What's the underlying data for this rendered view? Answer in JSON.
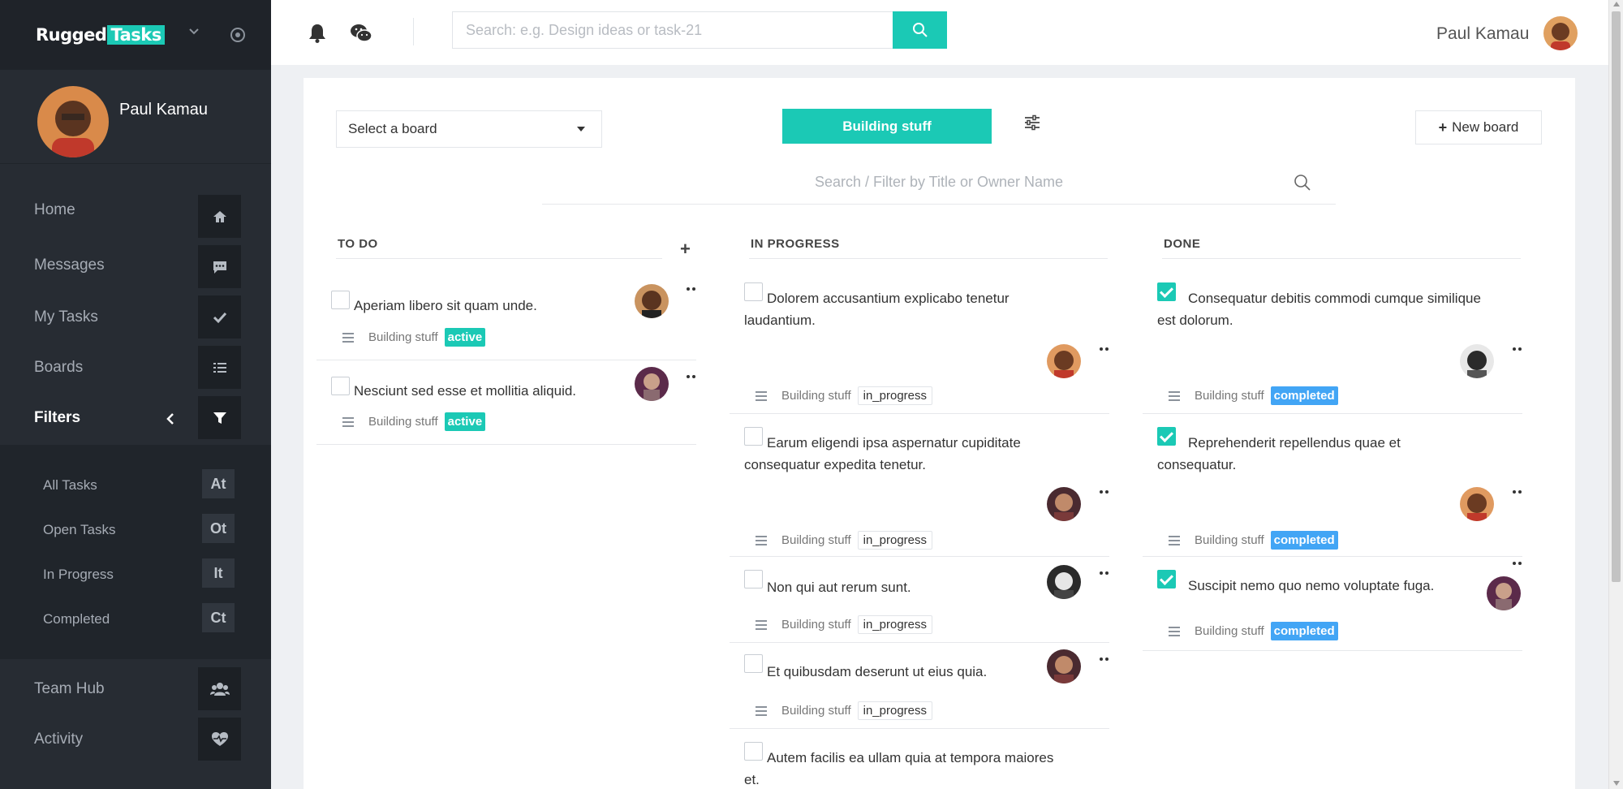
{
  "sidebar": {
    "brand_prefix": "Rugged",
    "brand_suffix": "Tasks",
    "profile_name": "Paul Kamau",
    "nav": [
      {
        "label": "Home",
        "icon": "home-icon"
      },
      {
        "label": "Messages",
        "icon": "message-icon"
      },
      {
        "label": "My Tasks",
        "icon": "check-icon"
      },
      {
        "label": "Boards",
        "icon": "list-icon"
      },
      {
        "label": "Filters",
        "icon": "filter-icon"
      }
    ],
    "filters": [
      {
        "label": "All Tasks",
        "badge": "At"
      },
      {
        "label": "Open Tasks",
        "badge": "Ot"
      },
      {
        "label": "In Progress",
        "badge": "It"
      },
      {
        "label": "Completed",
        "badge": "Ct"
      }
    ],
    "bottom_nav": [
      {
        "label": "Team Hub",
        "icon": "users-icon"
      },
      {
        "label": "Activity",
        "icon": "heartbeat-icon"
      }
    ]
  },
  "topbar": {
    "search_placeholder": "Search: e.g. Design ideas or task-21",
    "user_name": "Paul Kamau"
  },
  "board": {
    "select_label": "Select a board",
    "current_board": "Building stuff",
    "new_board_label": "New board",
    "filter_placeholder": "Search / Filter by Title or Owner Name"
  },
  "columns": {
    "todo": {
      "title": "TO DO",
      "cards": [
        {
          "title": "Aperiam libero sit quam unde.",
          "board": "Building stuff",
          "status": "active"
        },
        {
          "title": "Nesciunt sed esse et mollitia aliquid.",
          "board": "Building stuff",
          "status": "active"
        }
      ]
    },
    "in_progress": {
      "title": "IN PROGRESS",
      "cards": [
        {
          "title": "Dolorem accusantium explicabo tenetur laudantium.",
          "board": "Building stuff",
          "status": "in_progress"
        },
        {
          "title": "Earum eligendi ipsa aspernatur cupiditate consequatur expedita tenetur.",
          "board": "Building stuff",
          "status": "in_progress"
        },
        {
          "title": "Non qui aut rerum sunt.",
          "board": "Building stuff",
          "status": "in_progress"
        },
        {
          "title": "Et quibusdam deserunt ut eius quia.",
          "board": "Building stuff",
          "status": "in_progress"
        },
        {
          "title": "Autem facilis ea ullam quia at tempora maiores et.",
          "board": "Building stuff",
          "status": "in_progress"
        }
      ]
    },
    "done": {
      "title": "DONE",
      "cards": [
        {
          "title": "Consequatur debitis commodi cumque similique est dolorum.",
          "board": "Building stuff",
          "status": "completed"
        },
        {
          "title": "Reprehenderit repellendus quae et consequatur.",
          "board": "Building stuff",
          "status": "completed"
        },
        {
          "title": "Suscipit nemo quo nemo voluptate fuga.",
          "board": "Building stuff",
          "status": "completed"
        }
      ]
    }
  },
  "colors": {
    "accent": "#1bc9b5",
    "completed": "#42a5f5",
    "sidebar": "#272c33"
  }
}
